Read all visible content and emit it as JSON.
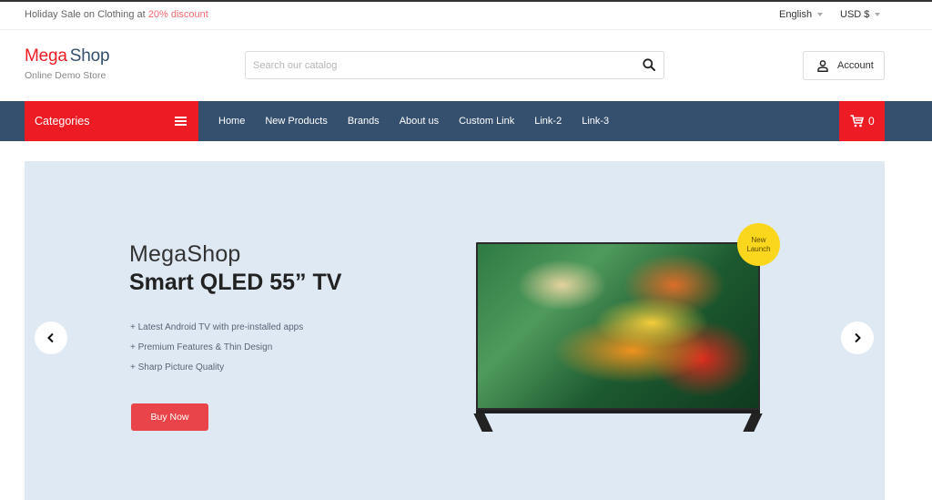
{
  "topbar": {
    "promo_text": "Holiday Sale on Clothing at ",
    "promo_highlight": "20% discount",
    "language": "English",
    "currency": "USD $"
  },
  "header": {
    "logo_part1": "Mega",
    "logo_part2": "Shop",
    "tagline": "Online Demo Store",
    "search_placeholder": "Search our catalog",
    "search_value": "",
    "account_label": "Account"
  },
  "nav": {
    "categories_label": "Categories",
    "links": [
      {
        "label": "Home"
      },
      {
        "label": "New Products"
      },
      {
        "label": "Brands"
      },
      {
        "label": "About us"
      },
      {
        "label": "Custom Link"
      },
      {
        "label": "Link-2"
      },
      {
        "label": "Link-3"
      }
    ],
    "cart_count": "0"
  },
  "banner": {
    "brand": "MegaShop",
    "title": "Smart QLED 55” TV",
    "features": [
      "+ Latest Android TV with pre-installed apps",
      "+ Premium Features & Thin Design",
      "+ Sharp Picture Quality"
    ],
    "cta_label": "Buy Now",
    "badge_line1": "New",
    "badge_line2": "Launch"
  },
  "colors": {
    "brand_red": "#ed1c24",
    "nav_blue": "#34506e",
    "banner_bg": "#dfe9f4",
    "badge_yellow": "#fad71c",
    "cta_red": "#e94449"
  }
}
